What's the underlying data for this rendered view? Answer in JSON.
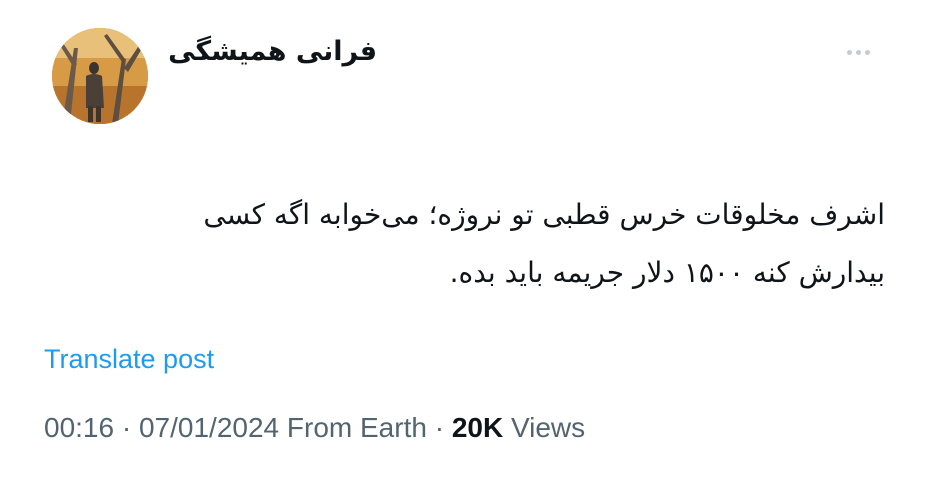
{
  "post": {
    "author_name": "فرانی همیشگی",
    "more_icon": "more-dots-icon",
    "text_lines": [
      "اشرف مخلوقات خرس قطبی تو نروژه؛ می‌خوابه اگه کسی",
      "بیدارش کنه ۱۵۰۰ دلار جریمه باید بده."
    ],
    "translate_label": "Translate post",
    "time": "00:16",
    "separator": "·",
    "date": "07/01/2024",
    "source": "From Earth",
    "views_count": "20K",
    "views_label": "Views"
  },
  "colors": {
    "link": "#1d9bf0",
    "secondary_text": "#536471",
    "primary_text": "#0f1419"
  }
}
